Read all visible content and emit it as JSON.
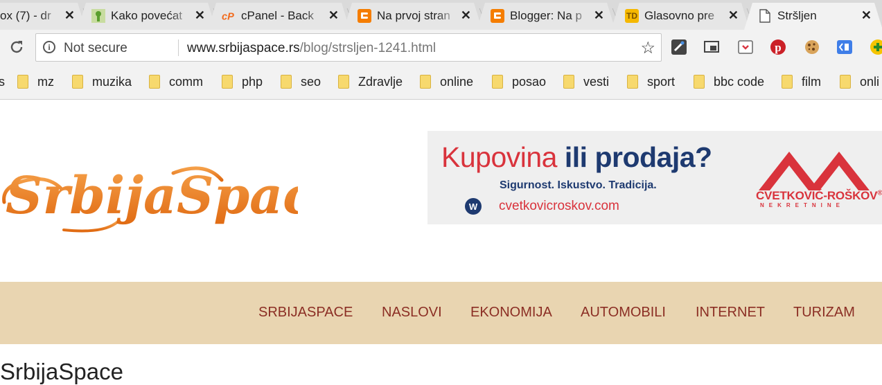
{
  "tabs": [
    {
      "title": "ox (7) - dr",
      "favicon": "gmail-icon"
    },
    {
      "title": "Kako povećat",
      "favicon": "android-icon"
    },
    {
      "title": "cPanel - Back",
      "favicon": "cpanel-icon"
    },
    {
      "title": "Na prvoj stran",
      "favicon": "blogger-icon"
    },
    {
      "title": "Blogger: Na p",
      "favicon": "blogger-icon"
    },
    {
      "title": "Glasovno pre",
      "favicon": "td-icon",
      "favicon_text": "TD"
    },
    {
      "title": "Stršljen",
      "favicon": "page-icon",
      "active": true
    }
  ],
  "toolbar": {
    "security_label": "Not secure",
    "url_host": "www.srbijaspace.rs",
    "url_path": "/blog/strsljen-1241.html"
  },
  "bookmarks": [
    {
      "label": "s"
    },
    {
      "label": "mz"
    },
    {
      "label": "muzika"
    },
    {
      "label": "comm"
    },
    {
      "label": "php"
    },
    {
      "label": "seo"
    },
    {
      "label": "Zdravlje"
    },
    {
      "label": "online"
    },
    {
      "label": "posao"
    },
    {
      "label": "vesti"
    },
    {
      "label": "sport"
    },
    {
      "label": "bbc code"
    },
    {
      "label": "film"
    },
    {
      "label": "onli"
    }
  ],
  "site": {
    "logo_text": "SrbijaSpace",
    "heading": "SrbijaSpace"
  },
  "ad": {
    "headline_part1": "Kupovina",
    "headline_part2": "ili  prodaja?",
    "tagline": "Sigurnost. Iskustvo. Tradicija.",
    "badge": "W",
    "website": "cvetkovicroskov.com",
    "brand": "CVETKOVIĆ-ROŠKOV",
    "brand_mark": "®",
    "brand_sub": "NEKRETNINE"
  },
  "nav": [
    {
      "label": "SRBIJASPACE"
    },
    {
      "label": "NASLOVI"
    },
    {
      "label": "EKONOMIJA"
    },
    {
      "label": "AUTOMOBILI"
    },
    {
      "label": "INTERNET"
    },
    {
      "label": "TURIZAM"
    }
  ],
  "colors": {
    "nav_background": "#e9d5b1",
    "nav_text": "#8b2e24",
    "logo_orange": "#ee7d1f",
    "ad_red": "#d9333c",
    "ad_navy": "#1e3a70"
  }
}
